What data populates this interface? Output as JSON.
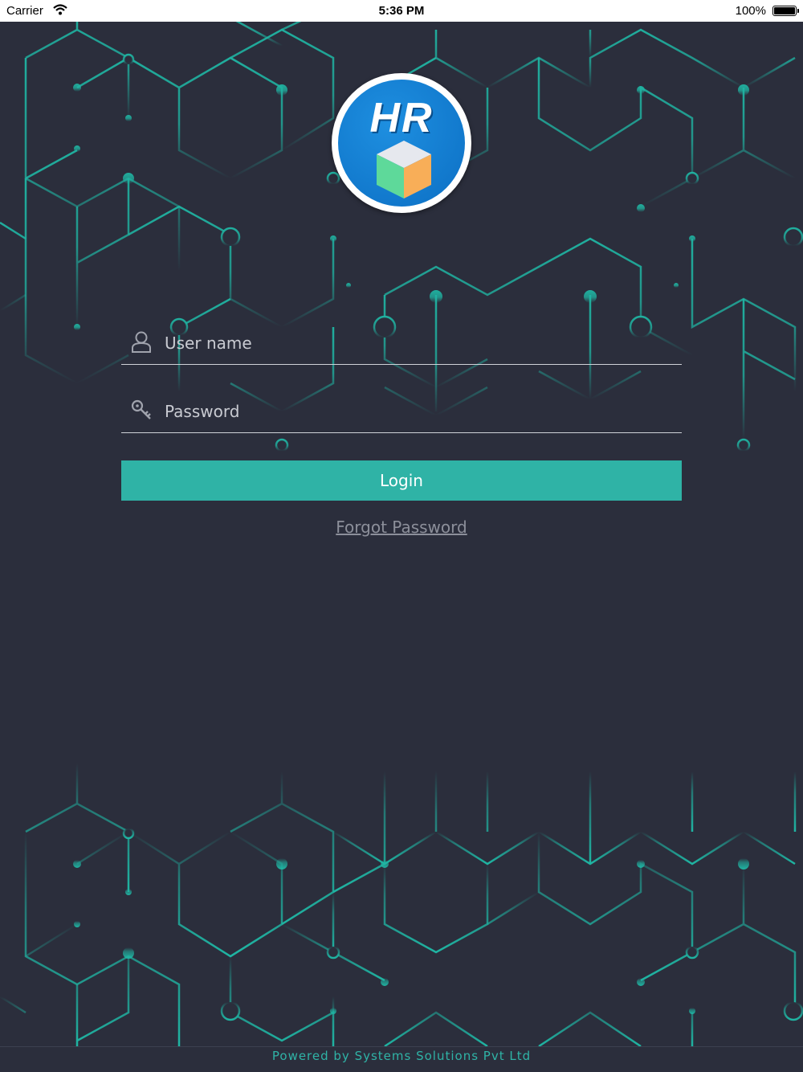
{
  "status_bar": {
    "carrier": "Carrier",
    "time": "5:36 PM",
    "battery": "100%"
  },
  "logo": {
    "text": "HR"
  },
  "login_form": {
    "username_placeholder": "User name",
    "password_placeholder": "Password",
    "login_label": "Login",
    "forgot_password_label": "Forgot Password"
  },
  "footer": {
    "text": "Powered by Systems Solutions Pvt Ltd"
  },
  "colors": {
    "background": "#2b2e3c",
    "accent": "#2fb3a6",
    "pattern": "#1fb5a3"
  }
}
